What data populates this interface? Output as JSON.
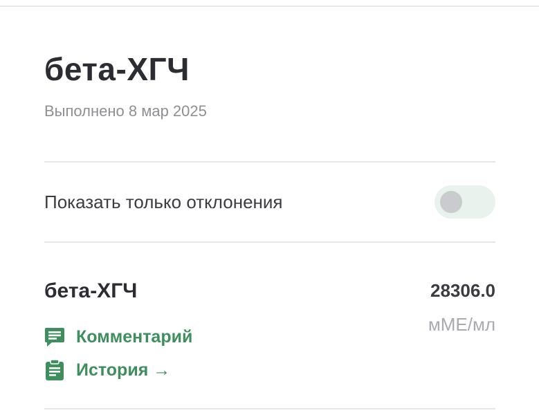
{
  "header": {
    "title": "бета-ХГЧ",
    "completed": "Выполнено 8 мар 2025"
  },
  "filter": {
    "label": "Показать только отклонения",
    "enabled": false
  },
  "result": {
    "name": "бета-ХГЧ",
    "value": "28306.0",
    "unit": "мМЕ/мл",
    "actions": [
      {
        "label": "Комментарий",
        "icon": "comment-icon"
      },
      {
        "label": "История →",
        "icon": "clipboard-icon"
      }
    ]
  },
  "colors": {
    "accent": "#3f8f5e",
    "toggle_track": "#e9f2ec",
    "toggle_knob": "#c9cbce",
    "text_primary": "#2c2d33",
    "text_muted": "#8d8f94"
  }
}
